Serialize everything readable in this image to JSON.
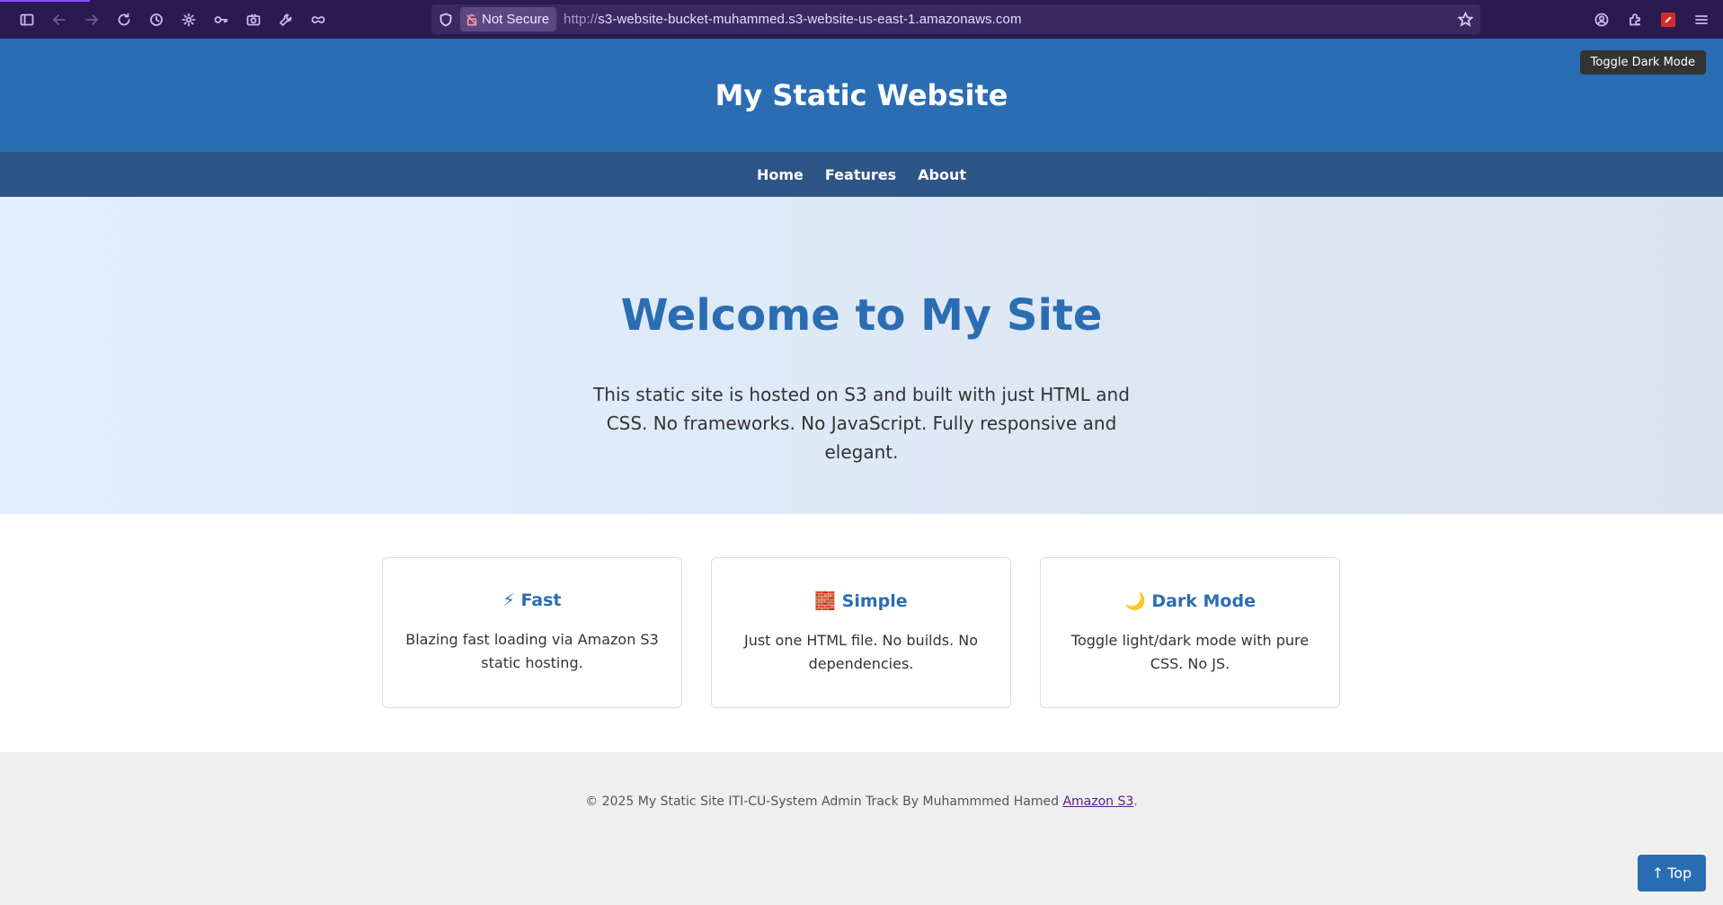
{
  "browser": {
    "security_label": "Not Secure",
    "url_protocol": "http://",
    "url_host": "s3-website-bucket-muhammed.s3-website-us-east-1.amazonaws.com",
    "nav_icons": [
      "sidebar-icon",
      "back-icon",
      "forward-icon",
      "reload-icon",
      "history-icon",
      "settings-icon",
      "key-icon",
      "screenshot-icon",
      "tools-icon",
      "private-mask-icon"
    ],
    "right_icons": [
      "account-icon",
      "extensions-icon",
      "pdf-icon",
      "menu-icon"
    ],
    "accent_color": "#2b1a4f"
  },
  "header": {
    "title": "My Static Website",
    "tooltip": "Toggle Dark Mode",
    "color": "#2b6db3"
  },
  "nav": {
    "items": [
      {
        "label": "Home"
      },
      {
        "label": "Features"
      },
      {
        "label": "About"
      }
    ],
    "color": "#2d5585"
  },
  "hero": {
    "title": "Welcome to My Site",
    "text": "This static site is hosted on S3 and built with just HTML and CSS. No frameworks. No JavaScript. Fully responsive and elegant."
  },
  "features": [
    {
      "icon": "⚡",
      "title": "Fast",
      "text": "Blazing fast loading via Amazon S3 static hosting."
    },
    {
      "icon": "🧱",
      "title": "Simple",
      "text": "Just one HTML file. No builds. No dependencies."
    },
    {
      "icon": "🌙",
      "title": "Dark Mode",
      "text": "Toggle light/dark mode with pure CSS. No JS."
    }
  ],
  "footer": {
    "text": "© 2025 My Static Site ITI-CU-System Admin Track By Muhammmed Hamed ",
    "link_label": "Amazon S3",
    "suffix": "."
  },
  "top_button": {
    "arrow": "↑",
    "label": "Top"
  }
}
